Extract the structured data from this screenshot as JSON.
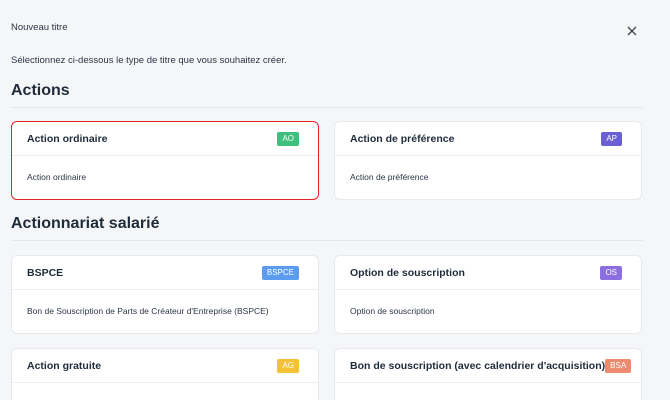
{
  "modal": {
    "title": "Nouveau titre",
    "intro": "Sélectionnez ci-dessous le type de titre que vous souhaitez créer."
  },
  "sections": [
    {
      "title": "Actions",
      "cards": [
        {
          "name": "Action ordinaire",
          "badge": "AO",
          "badge_color": "#3ebf7d",
          "description": "Action ordinaire",
          "selected": true
        },
        {
          "name": "Action de préférence",
          "badge": "AP",
          "badge_color": "#6a5fd3",
          "description": "Action de préférence",
          "selected": false
        }
      ]
    },
    {
      "title": "Actionnariat salarié",
      "cards": [
        {
          "name": "BSPCE",
          "badge": "BSPCE",
          "badge_color": "#5b9cf0",
          "description": "Bon de Souscription de Parts de Créateur d'Entreprise (BSPCE)",
          "selected": false
        },
        {
          "name": "Option de souscription",
          "badge": "OS",
          "badge_color": "#8b6fe0",
          "description": "Option de souscription",
          "selected": false
        },
        {
          "name": "Action gratuite",
          "badge": "AG",
          "badge_color": "#f3c237",
          "description": "",
          "selected": false
        },
        {
          "name": "Bon de souscription (avec calendrier d'acquisition)",
          "badge": "BSA",
          "badge_color": "#ee8a6f",
          "description": "",
          "selected": false
        }
      ]
    }
  ],
  "colors": {
    "selected_border": "#e02424",
    "background": "#f5f6f8"
  }
}
